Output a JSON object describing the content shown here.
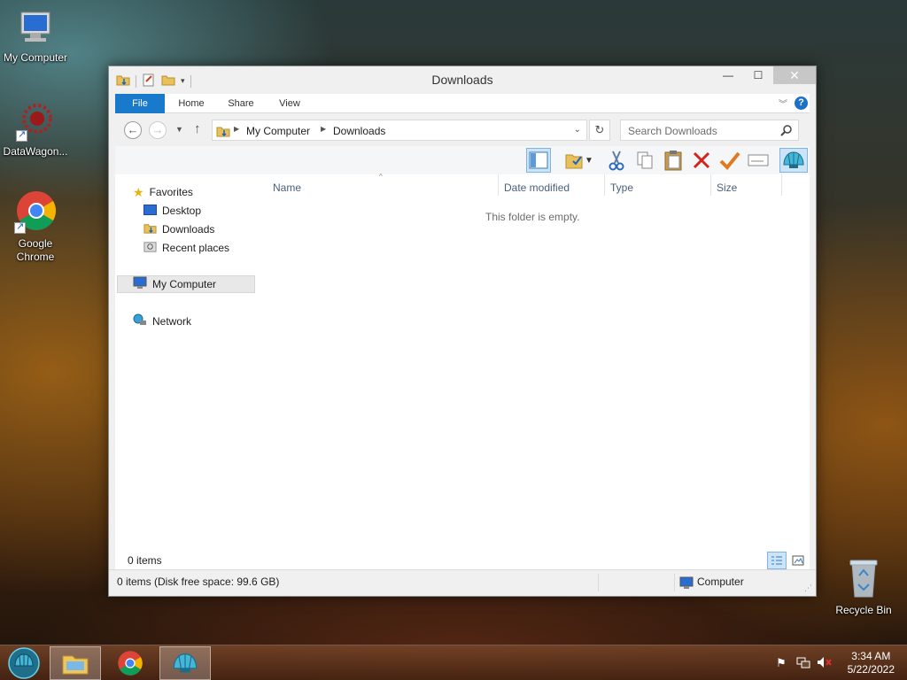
{
  "desktop": {
    "icons": [
      {
        "label": "My Computer"
      },
      {
        "label": "DataWagon..."
      },
      {
        "label": "Google Chrome"
      },
      {
        "label": "Recycle Bin"
      }
    ]
  },
  "window": {
    "title": "Downloads",
    "controls": {
      "minimize": "—",
      "maximize": "☐",
      "close": "✕"
    }
  },
  "ribbon": {
    "tabs": [
      {
        "label": "File"
      },
      {
        "label": "Home"
      },
      {
        "label": "Share"
      },
      {
        "label": "View"
      }
    ],
    "help": "?"
  },
  "address": {
    "breadcrumb": [
      "My Computer",
      "Downloads"
    ],
    "search_placeholder": "Search Downloads"
  },
  "nav_pane": {
    "favorites_label": "Favorites",
    "favorites": [
      {
        "label": "Desktop"
      },
      {
        "label": "Downloads"
      },
      {
        "label": "Recent places"
      }
    ],
    "computer_label": "My Computer",
    "network_label": "Network"
  },
  "file_list": {
    "columns": [
      "Name",
      "Date modified",
      "Type",
      "Size"
    ],
    "empty_message": "This folder is empty."
  },
  "items_bar": {
    "count": "0 items"
  },
  "status_bar": {
    "left": "0 items (Disk free space: 99.6 GB)",
    "right": "Computer"
  },
  "taskbar": {
    "time": "3:34 AM",
    "date": "5/22/2022"
  },
  "colors": {
    "accent": "#1979ca",
    "selected_bg": "#cce4f7",
    "selected_border": "#7eb4ea"
  }
}
